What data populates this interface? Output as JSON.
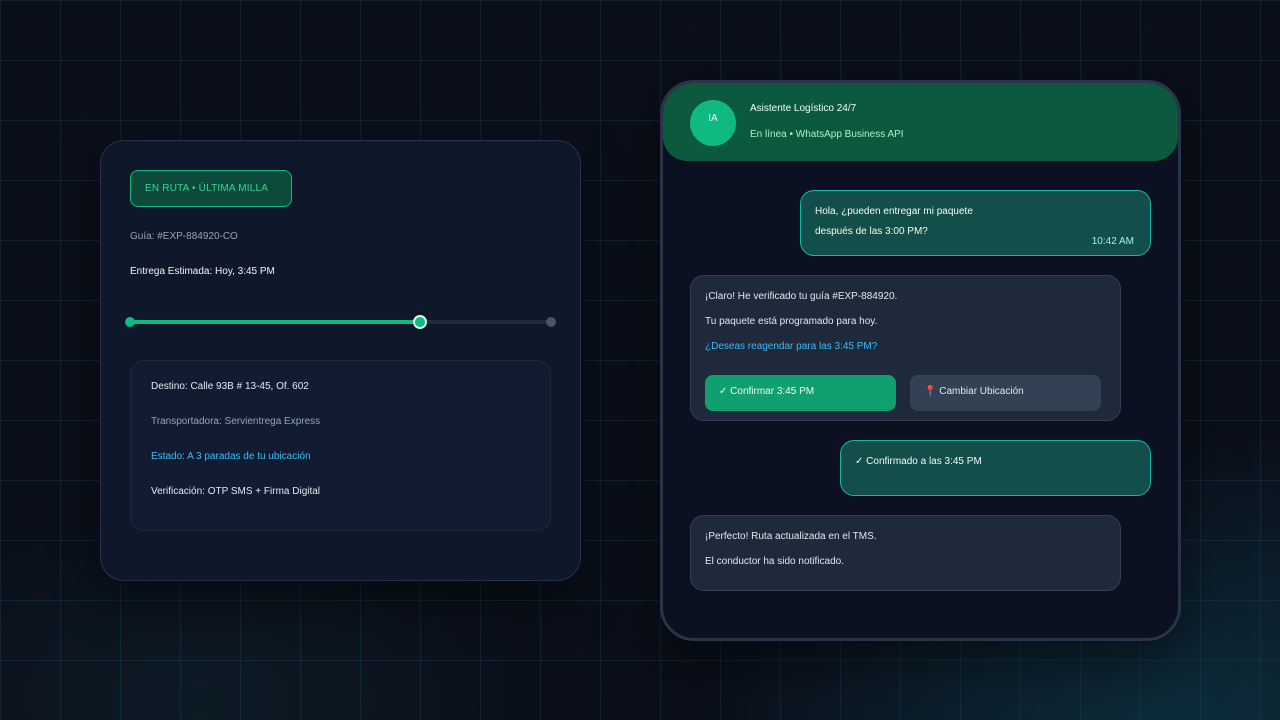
{
  "tracking": {
    "status_pill": "EN RUTA • ÚLTIMA MILLA",
    "guide": "Guía: #EXP-884920-CO",
    "eta": "Entrega Estimada: Hoy, 3:45 PM",
    "progress": 0.69,
    "details": {
      "destination": "Destino: Calle 93B # 13-45, Of. 602",
      "carrier": "Transportadora: Servientrega Express",
      "state": "Estado: A 3 paradas de tu ubicación",
      "verification": "Verificación: OTP SMS + Firma Digital"
    }
  },
  "chat": {
    "avatar": "IA",
    "title": "Asistente Logístico 24/7",
    "subtitle": "En línea • WhatsApp Business API",
    "messages": [
      {
        "lines": [
          "Hola, ¿pueden entregar mi paquete",
          "después de las 3:00 PM?"
        ],
        "time": "10:42 AM"
      },
      {
        "lines": [
          "¡Claro! He verificado tu guía #EXP-884920.",
          "Tu paquete está programado para hoy.",
          "¿Deseas reagendar para las 3:45 PM?"
        ],
        "actions": [
          "✓ Confirmar 3:45 PM",
          "📍 Cambiar Ubicación"
        ]
      },
      {
        "lines": [
          "✓ Confirmado a las 3:45 PM"
        ]
      },
      {
        "lines": [
          "¡Perfecto! Ruta actualizada en el TMS.",
          "El conductor ha sido notificado."
        ]
      }
    ]
  },
  "colors": {
    "accent": "#10b981",
    "link": "#38bdf8",
    "header_bg": "#0b5a3e"
  }
}
